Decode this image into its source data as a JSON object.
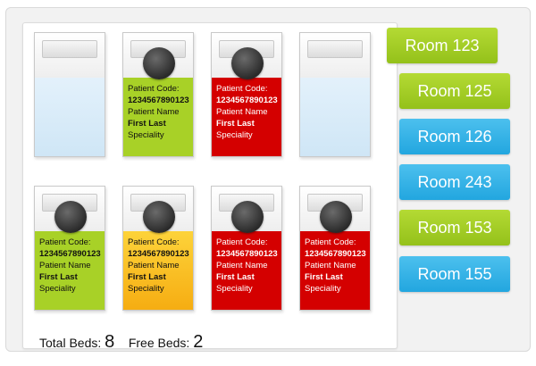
{
  "beds": [
    {
      "status": "free"
    },
    {
      "status": "green",
      "code_label": "Patient Code:",
      "code": "1234567890123",
      "name_label": "Patient Name",
      "name": "First Last",
      "speciality": "Speciality"
    },
    {
      "status": "red",
      "code_label": "Patient Code:",
      "code": "1234567890123",
      "name_label": "Patient Name",
      "name": "First Last",
      "speciality": "Speciality"
    },
    {
      "status": "free"
    },
    {
      "status": "green",
      "code_label": "Patient Code:",
      "code": "1234567890123",
      "name_label": "Patient Name",
      "name": "First Last",
      "speciality": "Speciality"
    },
    {
      "status": "orange",
      "code_label": "Patient Code:",
      "code": "1234567890123",
      "name_label": "Patient Name",
      "name": "First Last",
      "speciality": "Speciality"
    },
    {
      "status": "red",
      "code_label": "Patient Code:",
      "code": "1234567890123",
      "name_label": "Patient Name",
      "name": "First Last",
      "speciality": "Speciality"
    },
    {
      "status": "red",
      "code_label": "Patient Code:",
      "code": "1234567890123",
      "name_label": "Patient Name",
      "name": "First Last",
      "speciality": "Speciality"
    }
  ],
  "rooms": [
    {
      "label": "Room 123",
      "color": "green"
    },
    {
      "label": "Room 125",
      "color": "green"
    },
    {
      "label": "Room 126",
      "color": "blue"
    },
    {
      "label": "Room 243",
      "color": "blue"
    },
    {
      "label": "Room 153",
      "color": "green"
    },
    {
      "label": "Room 155",
      "color": "blue"
    }
  ],
  "footer": {
    "total_label": "Total Beds:",
    "total_value": "8",
    "free_label": "Free Beds:",
    "free_value": "2"
  },
  "colors": {
    "green": "#a8d127",
    "red": "#d40000",
    "orange": "#f6ad12",
    "blue": "#22a6df"
  }
}
